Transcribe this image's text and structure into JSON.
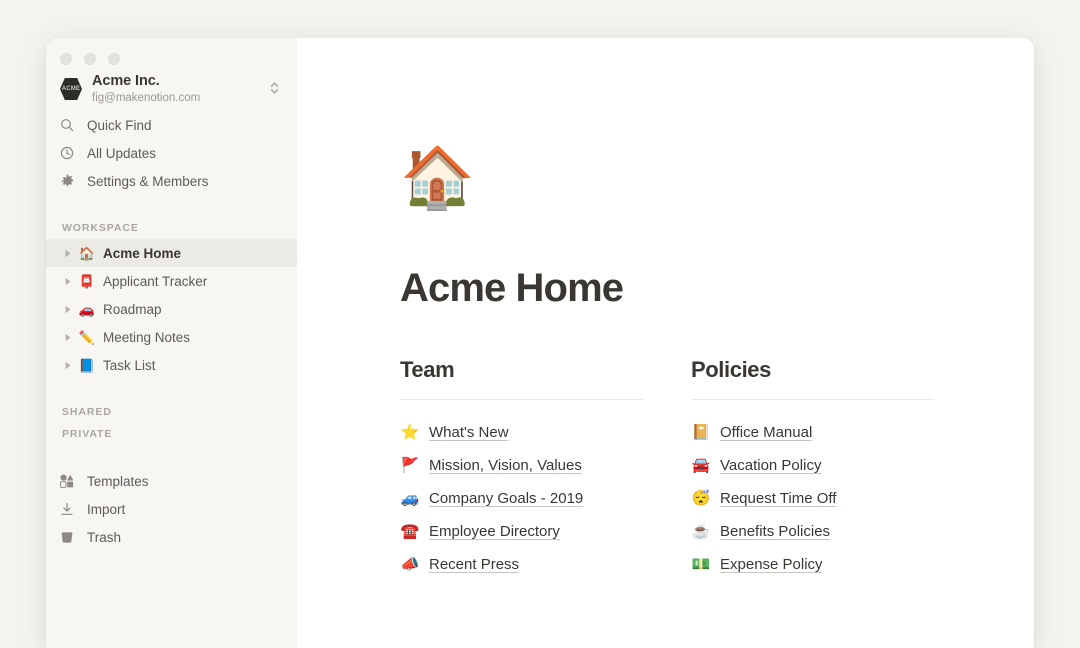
{
  "window": {
    "traffic_lights": [
      "close",
      "minimize",
      "zoom"
    ]
  },
  "sidebar": {
    "account": {
      "badge_text": "ACME",
      "name": "Acme Inc.",
      "email": "fig@makenotion.com",
      "switcher_icon": "chevron-up-down-icon"
    },
    "nav": [
      {
        "label": "Quick Find",
        "icon": "search-icon"
      },
      {
        "label": "All Updates",
        "icon": "clock-icon"
      },
      {
        "label": "Settings & Members",
        "icon": "gear-icon"
      }
    ],
    "sections": {
      "workspace_label": "WORKSPACE",
      "shared_label": "SHARED",
      "private_label": "PRIVATE"
    },
    "workspace_pages": [
      {
        "label": "Acme Home",
        "emoji": "🏠",
        "active": true
      },
      {
        "label": "Applicant Tracker",
        "emoji": "📮",
        "active": false
      },
      {
        "label": "Roadmap",
        "emoji": "🚗",
        "active": false
      },
      {
        "label": "Meeting Notes",
        "emoji": "✏️",
        "active": false
      },
      {
        "label": "Task List",
        "emoji": "📘",
        "active": false
      }
    ],
    "utility": [
      {
        "label": "Templates",
        "icon": "templates-icon"
      },
      {
        "label": "Import",
        "icon": "download-icon"
      },
      {
        "label": "Trash",
        "icon": "trash-icon"
      }
    ]
  },
  "main": {
    "page_icon": "🏠",
    "page_title": "Acme Home",
    "columns": [
      {
        "title": "Team",
        "links": [
          {
            "label": "What's New",
            "emoji": "⭐"
          },
          {
            "label": "Mission, Vision, Values",
            "emoji": "🚩"
          },
          {
            "label": "Company Goals - 2019",
            "emoji": "🚙"
          },
          {
            "label": "Employee Directory",
            "emoji": "☎️"
          },
          {
            "label": "Recent Press",
            "emoji": "📣"
          }
        ]
      },
      {
        "title": "Policies",
        "links": [
          {
            "label": "Office Manual",
            "emoji": "📔"
          },
          {
            "label": "Vacation Policy",
            "emoji": "🚘"
          },
          {
            "label": "Request Time Off",
            "emoji": "😴"
          },
          {
            "label": "Benefits Policies",
            "emoji": "☕"
          },
          {
            "label": "Expense Policy",
            "emoji": "💵"
          }
        ]
      }
    ]
  },
  "colors": {
    "app_background": "#f4f3ef",
    "sidebar_background": "#f7f6f3",
    "content_background": "#ffffff",
    "active_row": "#eceae5",
    "text_primary": "#3a3733",
    "text_secondary": "#5e5b56",
    "text_muted": "#aaa7a0"
  }
}
